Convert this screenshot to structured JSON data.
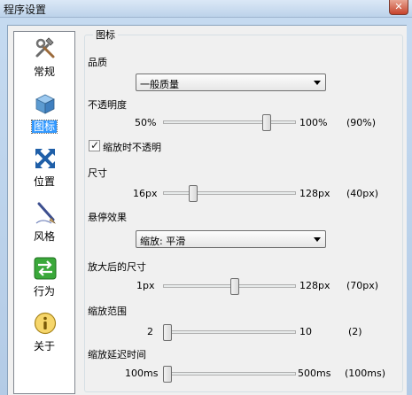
{
  "window": {
    "title": "程序设置",
    "close_glyph": "✕"
  },
  "nav": {
    "items": [
      {
        "label": "常规",
        "icon": "tools-icon"
      },
      {
        "label": "图标",
        "icon": "box-icon",
        "selected": true
      },
      {
        "label": "位置",
        "icon": "move-arrows-icon"
      },
      {
        "label": "风格",
        "icon": "pen-icon"
      },
      {
        "label": "行为",
        "icon": "arrows-exchange-icon"
      },
      {
        "label": "关于",
        "icon": "info-icon"
      }
    ]
  },
  "panel": {
    "group_title": "图标",
    "quality": {
      "label": "品质",
      "value": "一般质量"
    },
    "opacity": {
      "label": "不透明度",
      "min": "50%",
      "max": "100%",
      "current": "(90%)",
      "level": 0.8
    },
    "opaque_on_zoom": {
      "label": "缩放时不透明",
      "checked": true
    },
    "size": {
      "label": "尺寸",
      "min": "16px",
      "max": "128px",
      "current": "(40px)",
      "level": 0.21
    },
    "hover_effect": {
      "label": "悬停效果",
      "value": "缩放: 平滑"
    },
    "zoomed_size": {
      "label": "放大后的尺寸",
      "min": "1px",
      "max": "128px",
      "current": "(70px)",
      "level": 0.54
    },
    "zoom_range": {
      "label": "缩放范围",
      "min": "2",
      "max": "10",
      "current": "(2)",
      "level": 0.0
    },
    "zoom_delay": {
      "label": "缩放延迟时间",
      "min": "100ms",
      "max": "500ms",
      "current": "(100ms)",
      "level": 0.0
    }
  }
}
